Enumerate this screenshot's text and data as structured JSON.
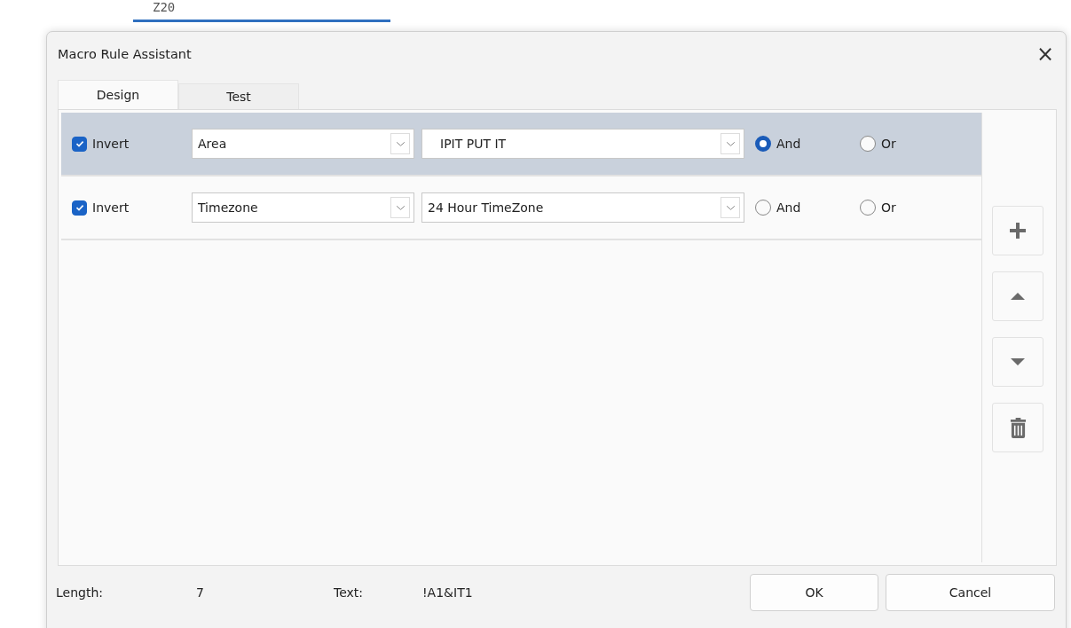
{
  "background": {
    "cell_reference": "Z20"
  },
  "window": {
    "title": "Macro Rule Assistant",
    "close": "×"
  },
  "tabs": [
    {
      "label": "Design",
      "selected": true
    },
    {
      "label": "Test",
      "selected": false
    }
  ],
  "rules": [
    {
      "invert_label": "Invert",
      "invert": true,
      "field": "Area",
      "value": "IPIT PUT IT",
      "and_label": "And",
      "or_label": "Or",
      "and_selected": true,
      "or_selected": false,
      "selected": true
    },
    {
      "invert_label": "Invert",
      "invert": true,
      "field": "Timezone",
      "value": "24 Hour TimeZone",
      "and_label": "And",
      "or_label": "Or",
      "and_selected": false,
      "or_selected": false,
      "selected": false
    }
  ],
  "side_buttons": [
    {
      "kind": "add"
    },
    {
      "kind": "up"
    },
    {
      "kind": "down"
    },
    {
      "kind": "delete"
    }
  ],
  "footer": {
    "length_label": "Length:",
    "length": "7",
    "text_label": "Text:",
    "text": "!A1&IT1"
  },
  "buttons": [
    "OK",
    "Cancel"
  ]
}
